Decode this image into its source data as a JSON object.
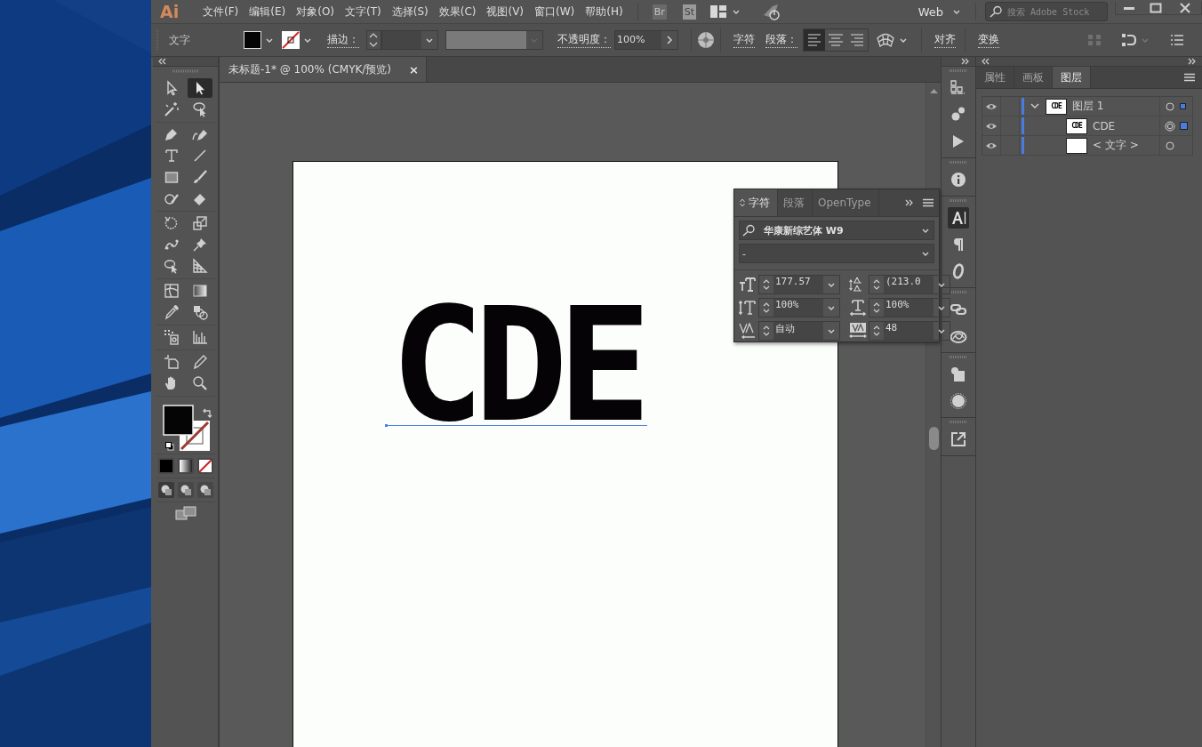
{
  "app_logo": "Ai",
  "menu": [
    {
      "label": "文件(F)"
    },
    {
      "label": "编辑(E)"
    },
    {
      "label": "对象(O)"
    },
    {
      "label": "文字(T)"
    },
    {
      "label": "选择(S)"
    },
    {
      "label": "效果(C)"
    },
    {
      "label": "视图(V)"
    },
    {
      "label": "窗口(W)"
    },
    {
      "label": "帮助(H)"
    }
  ],
  "app_bar": {
    "bridge": "Br",
    "stock": "St",
    "workspace": "Web",
    "search": {
      "placeholder": "搜索 Adobe Stock"
    }
  },
  "control_bar": {
    "selection_label": "文字",
    "stroke_label": "描边：",
    "opacity_label": "不透明度：",
    "opacity": "100%",
    "character_link": "字符",
    "paragraph_label": "段落：",
    "align": [
      {
        "selected": true
      },
      {
        "selected": false
      },
      {
        "selected": false
      }
    ],
    "align_link": "对齐",
    "transform_link": "变换"
  },
  "document_tab": {
    "title": "未标题-1* @ 100% (CMYK/预览)",
    "close": "×"
  },
  "tools": [
    {
      "selected": false
    },
    {
      "selected": true
    },
    {
      "selected": false
    },
    {
      "selected": false
    },
    {
      "selected": false
    },
    {
      "selected": false
    },
    {
      "selected": false
    },
    {
      "selected": false
    },
    {
      "selected": false
    },
    {
      "selected": false
    },
    {
      "selected": false
    },
    {
      "selected": false
    },
    {
      "selected": false
    },
    {
      "selected": false
    },
    {
      "selected": false
    },
    {
      "selected": false
    },
    {
      "selected": false
    },
    {
      "selected": false
    },
    {
      "selected": false
    },
    {
      "selected": false
    },
    {
      "selected": false
    },
    {
      "selected": false
    },
    {
      "selected": false
    },
    {
      "selected": false
    },
    {
      "selected": false
    },
    {
      "selected": false
    },
    {
      "selected": false
    },
    {
      "selected": false
    }
  ],
  "artboard": {
    "text": "CDE"
  },
  "character_panel": {
    "tabs": [
      {
        "label": "字符",
        "selected": true
      },
      {
        "label": "段落",
        "selected": false
      },
      {
        "label": "OpenType",
        "selected": false
      }
    ],
    "font_family": "华康新综艺体 W9",
    "font_style": "-",
    "fields": [
      {
        "value": "177.57"
      },
      {
        "value": "(213.0"
      },
      {
        "value": "100%"
      },
      {
        "value": "100%"
      },
      {
        "value": "自动"
      },
      {
        "value": "48"
      }
    ]
  },
  "layers_panel": {
    "tabs": [
      {
        "label": "属性",
        "selected": false
      },
      {
        "label": "画板",
        "selected": false
      },
      {
        "label": "图层",
        "selected": true
      }
    ],
    "layers": [
      {
        "name": "图层 1",
        "thumbnail": "CDE",
        "expanded": true,
        "targeted": false,
        "selected": false,
        "contains_selection": true,
        "children": [
          {
            "name": "CDE",
            "thumbnail": "CDE",
            "targeted": true,
            "selected": true
          },
          {
            "name": "< 文字 >",
            "targeted": false,
            "selected": false
          }
        ]
      }
    ]
  }
}
